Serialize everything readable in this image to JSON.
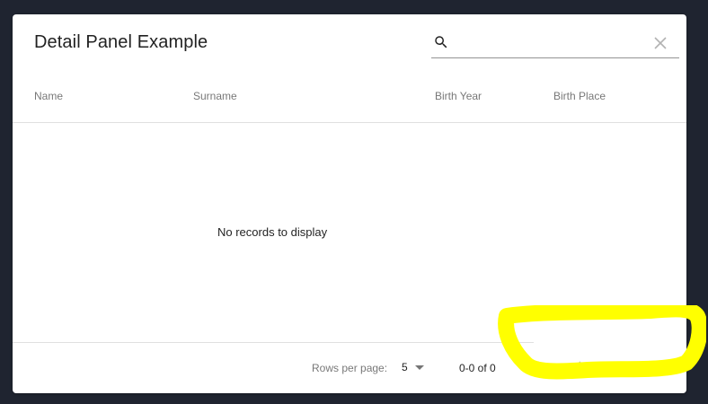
{
  "table": {
    "title": "Detail Panel Example",
    "search": {
      "value": "",
      "placeholder": ""
    },
    "columns": [
      {
        "label": "Name"
      },
      {
        "label": "Surname"
      },
      {
        "label": "Birth Year"
      },
      {
        "label": "Birth Place"
      }
    ],
    "empty_message": "No records to display",
    "pagination": {
      "rows_per_page_label": "Rows per page:",
      "rows_per_page_value": "5",
      "range_text": "0-0 of 0"
    }
  },
  "colors": {
    "page_background": "#1f2430",
    "card_background": "#ffffff",
    "highlight_marker": "#ffff00"
  },
  "icons": {
    "search": "search-icon",
    "clear": "close-icon",
    "first_page": "first-page-icon",
    "previous_page": "chevron-left-icon",
    "next_page": "chevron-right-icon",
    "last_page": "last-page-icon"
  }
}
